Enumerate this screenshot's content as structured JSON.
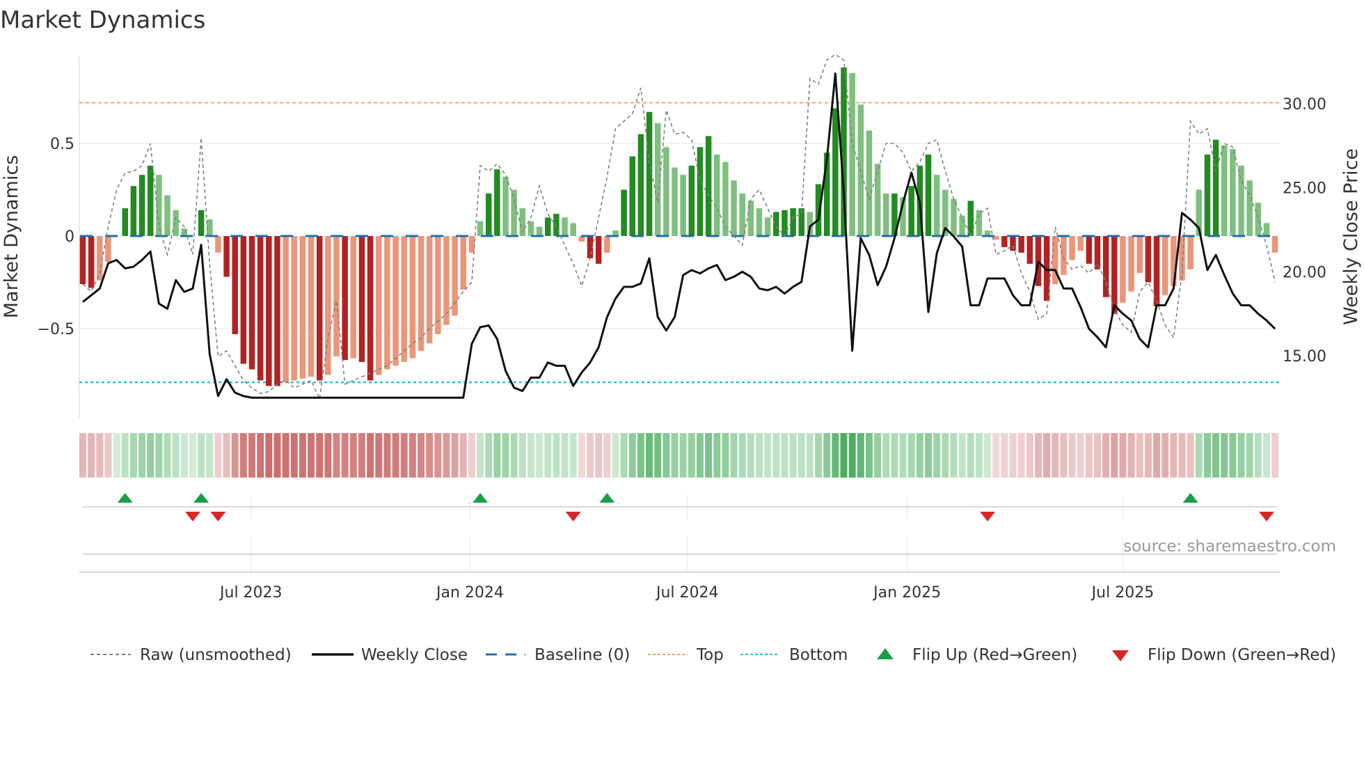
{
  "chart_data": {
    "type": "bar",
    "title": "Market Dynamics",
    "ylabel": "Market Dynamics",
    "ylabel_right": "Weekly Close Price",
    "ylim": [
      -1.0,
      1.0
    ],
    "ylim_right": [
      10.9,
      33.3
    ],
    "yticks": [
      {
        "value": 0.5,
        "label": "0.5"
      },
      {
        "value": 0,
        "label": "0"
      },
      {
        "value": -0.5,
        "label": "−0.5"
      }
    ],
    "yticks_right": [
      {
        "value": 30,
        "label": "30.00"
      },
      {
        "value": 25,
        "label": "25.00"
      },
      {
        "value": 20,
        "label": "20.00"
      },
      {
        "value": 15,
        "label": "15.00"
      }
    ],
    "xticks": [
      {
        "week_index": 19.9,
        "label": "Jul 2023"
      },
      {
        "week_index": 45.8,
        "label": "Jan 2024"
      },
      {
        "week_index": 71.5,
        "label": "Jul 2024"
      },
      {
        "week_index": 97.5,
        "label": "Jan 2025"
      },
      {
        "week_index": 123.0,
        "label": "Jul 2025"
      }
    ],
    "top_level": 0.72,
    "bottom_level": -0.79,
    "baseline": 0,
    "values": [
      -0.26,
      -0.28,
      -0.24,
      -0.14,
      0.0,
      0.15,
      0.27,
      0.33,
      0.38,
      0.33,
      0.22,
      0.14,
      0.04,
      0.0,
      0.14,
      0.09,
      -0.09,
      -0.22,
      -0.53,
      -0.69,
      -0.72,
      -0.78,
      -0.81,
      -0.81,
      -0.79,
      -0.78,
      -0.77,
      -0.76,
      -0.78,
      -0.75,
      -0.65,
      -0.67,
      -0.66,
      -0.68,
      -0.78,
      -0.75,
      -0.72,
      -0.7,
      -0.68,
      -0.66,
      -0.62,
      -0.58,
      -0.53,
      -0.48,
      -0.43,
      -0.29,
      -0.09,
      0.08,
      0.23,
      0.36,
      0.32,
      0.25,
      0.15,
      0.08,
      0.05,
      0.1,
      0.12,
      0.1,
      0.07,
      -0.03,
      -0.12,
      -0.15,
      -0.09,
      0.03,
      0.25,
      0.43,
      0.55,
      0.67,
      0.61,
      0.48,
      0.37,
      0.33,
      0.38,
      0.48,
      0.54,
      0.44,
      0.4,
      0.3,
      0.23,
      0.19,
      0.15,
      0.1,
      0.13,
      0.14,
      0.15,
      0.15,
      0.13,
      0.28,
      0.45,
      0.69,
      0.91,
      0.88,
      0.71,
      0.57,
      0.39,
      0.23,
      0.23,
      0.21,
      0.27,
      0.38,
      0.44,
      0.33,
      0.25,
      0.2,
      0.11,
      0.19,
      0.14,
      0.03,
      -0.02,
      -0.06,
      -0.08,
      -0.09,
      -0.15,
      -0.27,
      -0.35,
      -0.26,
      -0.21,
      -0.13,
      -0.08,
      -0.15,
      -0.18,
      -0.33,
      -0.42,
      -0.36,
      -0.3,
      -0.2,
      -0.25,
      -0.38,
      -0.32,
      -0.27,
      -0.24,
      -0.18,
      0.25,
      0.44,
      0.52,
      0.49,
      0.47,
      0.38,
      0.3,
      0.18,
      0.07,
      -0.09
    ],
    "raw": [
      -0.26,
      -0.3,
      -0.2,
      0.05,
      0.25,
      0.34,
      0.35,
      0.38,
      0.5,
      0.05,
      -0.1,
      0.1,
      0.05,
      -0.1,
      0.53,
      -0.15,
      -0.65,
      -0.62,
      -0.7,
      -0.78,
      -0.82,
      -0.85,
      -0.84,
      -0.8,
      -0.78,
      -0.82,
      -0.8,
      -0.78,
      -0.88,
      -0.55,
      -0.35,
      -0.8,
      -0.78,
      -0.76,
      -0.74,
      -0.72,
      -0.7,
      -0.66,
      -0.62,
      -0.58,
      -0.55,
      -0.5,
      -0.46,
      -0.42,
      -0.36,
      -0.3,
      -0.25,
      0.38,
      0.35,
      0.39,
      0.33,
      0.2,
      0.02,
      0.1,
      0.27,
      0.12,
      0.05,
      -0.05,
      -0.15,
      -0.27,
      -0.12,
      0.1,
      0.32,
      0.58,
      0.62,
      0.66,
      0.8,
      0.4,
      0.18,
      0.68,
      0.55,
      0.56,
      0.52,
      0.3,
      0.22,
      0.15,
      0.05,
      0.0,
      -0.05,
      0.2,
      0.25,
      0.15,
      0.05,
      0.0,
      0.1,
      0.12,
      0.85,
      0.82,
      0.95,
      0.98,
      0.95,
      0.5,
      0.35,
      0.2,
      0.35,
      0.5,
      0.5,
      0.45,
      0.35,
      0.4,
      0.5,
      0.52,
      0.35,
      0.2,
      0.1,
      0.0,
      0.12,
      0.15,
      -0.1,
      -0.08,
      -0.05,
      -0.2,
      -0.3,
      -0.45,
      -0.42,
      0.05,
      -0.12,
      -0.18,
      -0.16,
      -0.2,
      -0.15,
      -0.25,
      -0.4,
      -0.48,
      -0.52,
      -0.3,
      -0.25,
      -0.35,
      -0.48,
      -0.55,
      -0.2,
      0.62,
      0.55,
      0.58,
      0.35,
      0.5,
      0.48,
      0.3,
      0.22,
      0.1,
      -0.05,
      -0.25
    ],
    "weekly_close": [
      18.2,
      18.6,
      19.0,
      20.5,
      20.7,
      20.2,
      20.3,
      20.7,
      21.2,
      18.1,
      17.8,
      19.5,
      18.8,
      19.0,
      21.6,
      15.1,
      12.6,
      13.6,
      12.8,
      12.6,
      12.5,
      12.5,
      12.5,
      12.5,
      12.5,
      12.5,
      12.5,
      12.5,
      12.5,
      12.5,
      12.5,
      12.5,
      12.5,
      12.5,
      12.5,
      12.5,
      12.5,
      12.5,
      12.5,
      12.5,
      12.5,
      12.5,
      12.5,
      12.5,
      12.5,
      12.5,
      15.7,
      16.7,
      16.8,
      16.0,
      14.1,
      13.1,
      12.9,
      13.7,
      13.7,
      14.6,
      14.4,
      14.4,
      13.2,
      14.0,
      14.6,
      15.5,
      17.3,
      18.4,
      19.1,
      19.1,
      19.3,
      20.8,
      17.3,
      16.5,
      17.3,
      19.8,
      20.1,
      19.9,
      20.2,
      20.4,
      19.5,
      19.7,
      20.0,
      19.7,
      19.0,
      18.9,
      19.1,
      18.7,
      19.1,
      19.4,
      22.7,
      23.1,
      26.7,
      31.8,
      24.7,
      15.3,
      22.0,
      21.0,
      19.2,
      20.3,
      22.0,
      24.1,
      25.9,
      24.1,
      17.6,
      21.1,
      22.6,
      22.1,
      21.5,
      18.0,
      18.0,
      19.6,
      19.6,
      19.6,
      18.6,
      18.0,
      18.0,
      20.6,
      20.1,
      20.1,
      19.0,
      19.0,
      17.9,
      16.6,
      16.1,
      15.5,
      18.0,
      17.5,
      17.1,
      16.0,
      15.5,
      18.0,
      18.0,
      19.0,
      23.5,
      23.1,
      22.6,
      20.1,
      21.0,
      19.8,
      18.7,
      18.0,
      18.0,
      17.5,
      17.1,
      16.6
    ],
    "flip_up_indices": [
      5,
      14,
      47,
      62,
      131
    ],
    "flip_down_indices": [
      13,
      16,
      58,
      107,
      140
    ],
    "legend": {
      "raw": "Raw (unsmoothed)",
      "close": "Weekly Close",
      "baseline": "Baseline (0)",
      "top": "Top",
      "bottom": "Bottom",
      "flip_up": "Flip Up (Red→Green)",
      "flip_down": "Flip Down (Green→Red)"
    },
    "legend_placement": "bottom",
    "source": "source: sharemaestro.com",
    "colors": {
      "pos_strong": "#228b22",
      "pos_weak": "#7fbf7f",
      "neg_strong": "#b22222",
      "neg_weak": "#e9967a",
      "close": "#111111",
      "raw": "#808080",
      "baseline": "#1f6fa8",
      "top": "#f4a460",
      "bottom": "#22c3d6",
      "flip_up": "#1a9e4a",
      "flip_down": "#d62728"
    }
  }
}
